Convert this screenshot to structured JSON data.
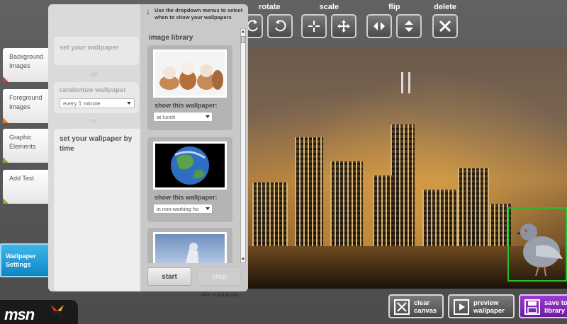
{
  "toolbar": {
    "rotate_label": "rotate",
    "scale_label": "scale",
    "flip_label": "flip",
    "delete_label": "delete"
  },
  "sidebar": {
    "tabs": [
      {
        "label": "Background Images",
        "color": "#e0332b"
      },
      {
        "label": "Foreground Images",
        "color": "#e9781e"
      },
      {
        "label": "Graphic Elements",
        "color": "#7ab22b"
      },
      {
        "label": "Add Text",
        "color": "#7ab22b"
      }
    ],
    "active_tab": {
      "label": "Wallpaper Settings",
      "color": "#1596d4"
    }
  },
  "settings": {
    "set_wallpaper": "set your wallpaper",
    "or": "or",
    "randomize": "randomize wallpaper",
    "interval": "every 1 minute",
    "by_time": "set your wallpaper by time"
  },
  "library": {
    "hint": "Use the dropdown menus to select when to show your wallpapers",
    "title": "image library",
    "items": [
      {
        "show_label": "show this wallpaper:",
        "when": "at lunch",
        "thumb": "puppies"
      },
      {
        "show_label": "show this wallpaper:",
        "when": "in non-working ho",
        "thumb": "earth"
      },
      {
        "thumb": "statue"
      }
    ],
    "start": "start",
    "stop": "stop"
  },
  "canvas": {
    "zoom_text": "42% of actual size",
    "photo": "city-skyline-night",
    "overlay": "pigeon"
  },
  "bottom": {
    "clear": "clear canvas",
    "preview": "preview wallpaper",
    "save": "save to library"
  },
  "logo": "msn",
  "colors": {
    "accent": "#1596d4",
    "save": "#7a2cae",
    "selection": "#22c02a"
  }
}
